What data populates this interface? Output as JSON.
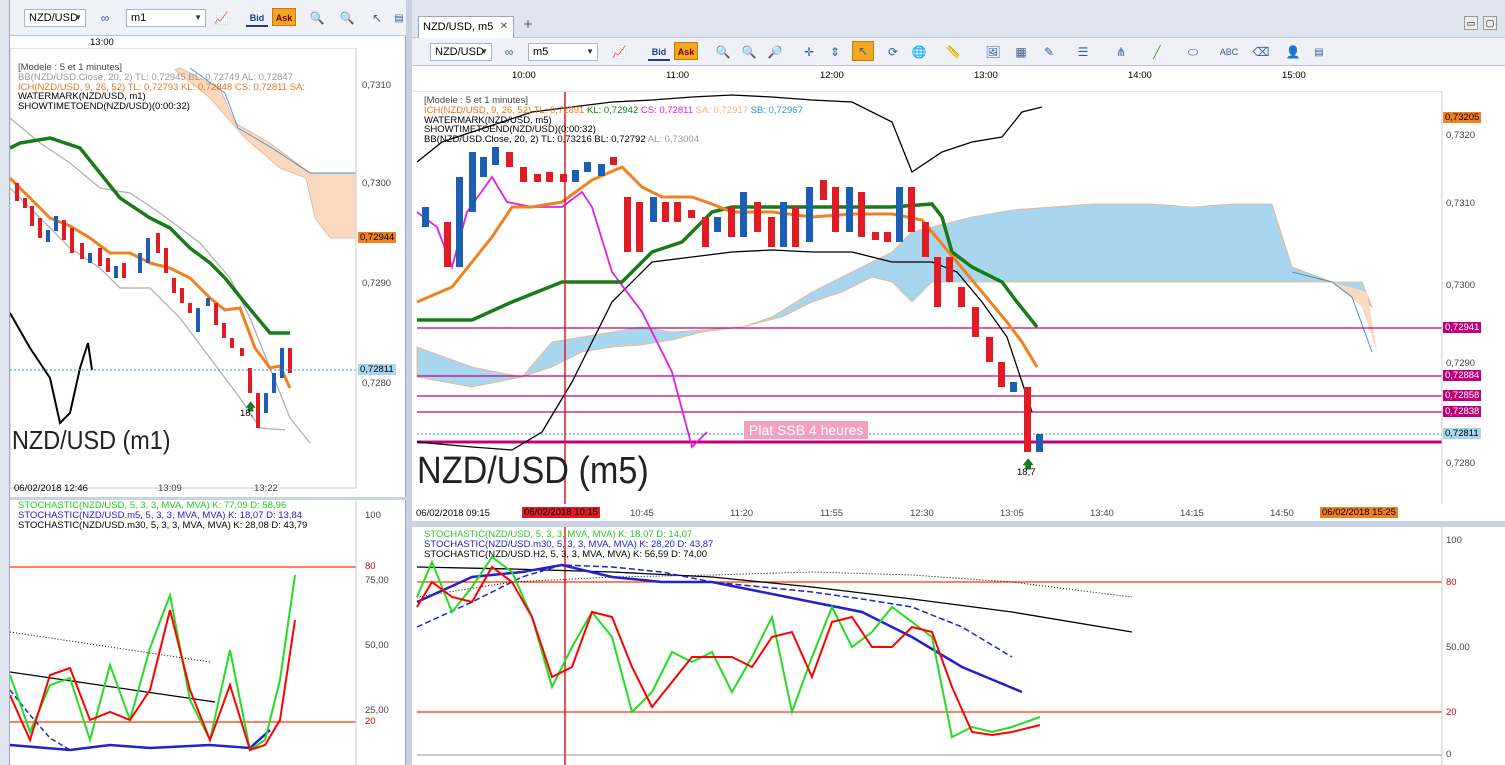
{
  "left_window": {
    "toolbar": {
      "symbol": "NZD/USD",
      "timeframe": "m1",
      "bid_label": "Bid",
      "ask_label": "Ask"
    },
    "top_time": "13:00",
    "legend": {
      "model": "[Modele : 5 et 1 minutes]",
      "bb": "BB(NZD/USD.Close, 20, 2)  TL: 0,72945  BL: 0,72749  AL: 0,72847",
      "ich": "ICH(NZD/USD, 9, 26, 52)  TL: 0,72793  KL: 0,72848  CS: 0,72811  SA:",
      "watermark": "WATERMARK(NZD/USD, m1)",
      "showtime": "SHOWTIMETOEND(NZD/USD)(0:00:32)"
    },
    "price_labels": [
      "0,7310",
      "0,7300",
      "0,7290",
      "0,7280"
    ],
    "price_badges": {
      "ich": "0,72944",
      "current": "0,72811"
    },
    "signal": "18,",
    "watermark_text": "NZD/USD (m1)",
    "time_labels": [
      "06/02/2018 12:46",
      "13:09",
      "13:22"
    ],
    "stoch_legend": {
      "a": "STOCHASTIC(NZD/USD, 5, 3, 3, MVA, MVA)  K: 77,09  D: 58,96",
      "b": "STOCHASTIC(NZD/USD.m5, 5, 3, 3, MVA, MVA)  K: 18,07  D: 13,84",
      "c": "STOCHASTIC(NZD/USD.m30, 5, 3, 3, MVA, MVA)  K: 28,08  D: 43,79"
    },
    "stoch_levels": [
      "100",
      "80",
      "75,00",
      "50,00",
      "25,00",
      "20"
    ]
  },
  "right_window": {
    "title": "NZD/USD, m5",
    "add_tab": "+",
    "toolbar": {
      "symbol": "NZD/USD",
      "timeframe": "m5",
      "bid_label": "Bid",
      "ask_label": "Ask"
    },
    "top_times": [
      "10:00",
      "11:00",
      "12:00",
      "13:00",
      "14:00",
      "15:00"
    ],
    "legend": {
      "model": "[Modele : 5 et 1 minutes]",
      "ich_a": "ICH(NZD/USD, 9, 26, 52)  TL: 0,72891",
      "ich_b": "KL: 0,72942",
      "ich_c": "CS: 0,72811",
      "ich_d": "SA: 0,72917",
      "ich_e": "SB: 0,72967",
      "watermark": "WATERMARK(NZD/USD, m5)",
      "showtime": "SHOWTIMETOEND(NZD/USD)(0:00:32)",
      "bb_a": "BB(NZD/USD.Close, 20, 2)  TL: 0,73216  BL: 0,72792",
      "bb_b": "AL: 0,73004"
    },
    "price_labels": [
      "0,7320",
      "0,7310",
      "0,7300",
      "0,7290",
      "0,7280"
    ],
    "price_badges": [
      "0,73205",
      "0,72941",
      "0,72884",
      "0,72858",
      "0,72838",
      "0,72811"
    ],
    "annotation": "Plat SSB 4 heures",
    "signal": "18,7",
    "watermark_text": "NZD/USD (m5)",
    "time_labels": [
      "06/02/2018 09:15",
      "06/02/2018 10:15",
      "10:45",
      "11:20",
      "11:55",
      "12:30",
      "13:05",
      "13:40",
      "14:15",
      "14:50",
      "06/02/2018 15:25"
    ],
    "stoch_legend": {
      "a": "STOCHASTIC(NZD/USD, 5, 3, 3, MVA, MVA)  K: 18,07  D: 14,07",
      "b": "STOCHASTIC(NZD/USD.m30, 5, 3, 3, MVA, MVA)  K: 28,20  D: 43,87",
      "c": "STOCHASTIC(NZD/USD.H2, 5, 3, 3, MVA, MVA)  K: 56,59  D: 74,00"
    },
    "stoch_levels": [
      "100",
      "80",
      "50,00",
      "20",
      "0"
    ]
  },
  "colors": {
    "up_candle": "#1a5fb4",
    "down_candle": "#e01b24",
    "kijun": "#1a7a1a",
    "tenkan": "#f08020",
    "chikou": "#e020e0",
    "kumo_bull": "#a8d6ef",
    "kumo_bear": "#fbd9c0",
    "level_line": "#c0007a",
    "stoch_red": "#ff0000",
    "stoch_green": "#22dd22",
    "stoch_blue": "#2222cc"
  },
  "icons": [
    "chain-link-icon",
    "chart-type-icon",
    "zoom-in-icon",
    "zoom-out-icon",
    "magnifier-icon",
    "crosshair-icon",
    "cursor-icon",
    "globe-icon",
    "ruler-icon",
    "image-icon",
    "indicators-icon",
    "drawing-icon",
    "line-style-icon",
    "trend-line-icon",
    "ellipse-icon",
    "text-icon",
    "eraser-icon",
    "user-icon",
    "menu-icon"
  ]
}
